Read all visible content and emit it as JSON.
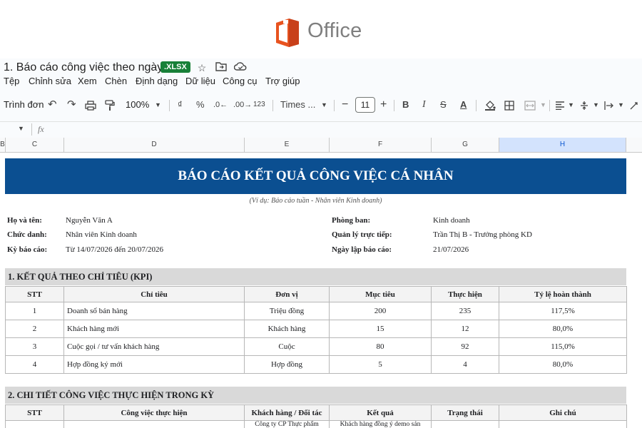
{
  "brand": {
    "name": "Office",
    "mark_color": "#e8531f"
  },
  "header": {
    "doc_title": "1. Báo cáo công việc theo ngày",
    "badge": ".XLSX",
    "icons": [
      "star-icon",
      "move-to-folder-icon",
      "cloud-status-icon"
    ]
  },
  "menu": [
    "Tệp",
    "Chỉnh sửa",
    "Xem",
    "Chèn",
    "Định dạng",
    "Dữ liệu",
    "Công cụ",
    "Trợ giúp"
  ],
  "toolbar": {
    "search_menu": "Trình đơn",
    "zoom": "100%",
    "currency": "₫",
    "percent": "%",
    "decrease_decimal": ".0←",
    "increase_decimal": ".00→",
    "number_format": "123",
    "font": "Times ...",
    "font_size": "11"
  },
  "formula_bar": {
    "fx": "fx"
  },
  "columns": [
    "B",
    "C",
    "D",
    "E",
    "F",
    "G",
    "H"
  ],
  "report": {
    "title": "BÁO CÁO KẾT QUẢ CÔNG VIỆC CÁ NHÂN",
    "subtitle": "(Ví dụ: Báo cáo tuần - Nhân viên Kinh doanh)",
    "name_label": "Họ và tên:",
    "name_value": "Nguyễn Văn A",
    "position_label": "Chức danh:",
    "position_value": "Nhân viên Kinh doanh",
    "period_label": "Kỳ báo cáo:",
    "period_value": "Từ 14/07/2026 đến 20/07/2026",
    "dept_label": "Phòng ban:",
    "dept_value": "Kinh doanh",
    "manager_label": "Quản lý trực tiếp:",
    "manager_value": "Trần Thị B - Trưởng phòng KD",
    "date_label": "Ngày lập báo cáo:",
    "date_value": "21/07/2026",
    "kpi_title": "1. KẾT QUẢ THEO CHỈ TIÊU (KPI)",
    "kpi_headers": [
      "STT",
      "Chỉ tiêu",
      "Đơn vị",
      "Mục tiêu",
      "Thực hiện",
      "Tỷ lệ hoàn thành"
    ],
    "kpi_rows": [
      [
        "1",
        "Doanh số bán hàng",
        "Triệu đồng",
        "200",
        "235",
        "117,5%"
      ],
      [
        "2",
        "Khách hàng mới",
        "Khách hàng",
        "15",
        "12",
        "80,0%"
      ],
      [
        "3",
        "Cuộc gọi / tư vấn khách hàng",
        "Cuộc",
        "80",
        "92",
        "115,0%"
      ],
      [
        "4",
        "Hợp đồng ký mới",
        "Hợp đồng",
        "5",
        "4",
        "80,0%"
      ]
    ],
    "detail_title": "2. CHI TIẾT CÔNG VIỆC THỰC HIỆN TRONG KỲ",
    "detail_headers": [
      "STT",
      "Công việc thực hiện",
      "Khách hàng / Đối tác",
      "Kết quả",
      "Trạng thái",
      "Ghi chú"
    ],
    "detail_partial": [
      "",
      "",
      "Công ty CP Thực phẩm",
      "Khách hàng đồng ý demo sản",
      "",
      ""
    ]
  }
}
